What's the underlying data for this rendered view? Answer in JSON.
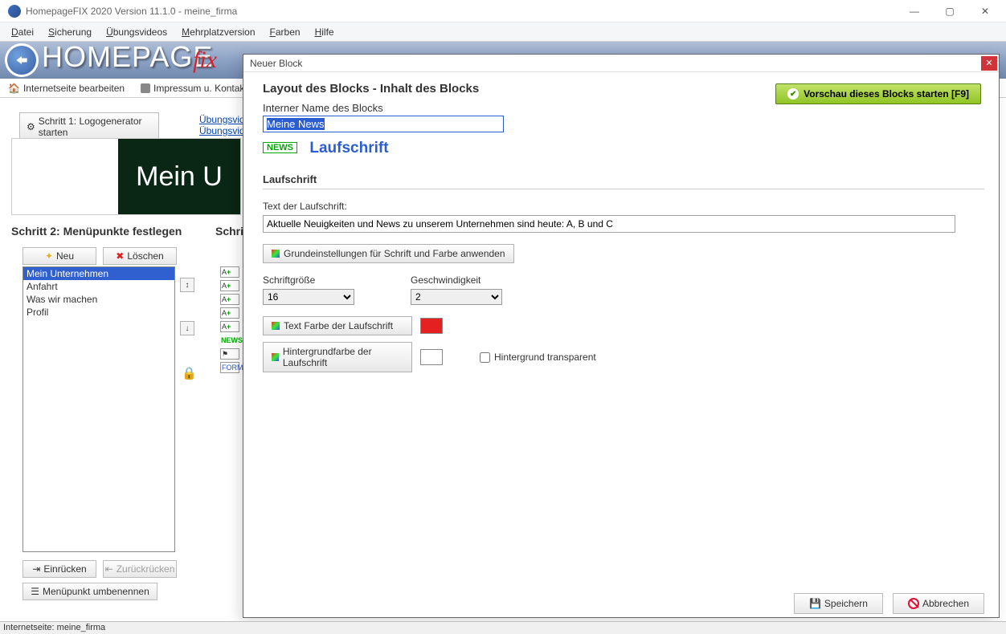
{
  "window": {
    "title": "HomepageFIX 2020 Version 11.1.0 - meine_firma"
  },
  "menus": [
    "Datei",
    "Sicherung",
    "Übungsvideos",
    "Mehrplatzversion",
    "Farben",
    "Hilfe"
  ],
  "banner": {
    "text": "HOMEPAGE",
    "cursive": "fix"
  },
  "tabs": {
    "edit": "Internetseite bearbeiten",
    "impressum": "Impressum u. Kontakt"
  },
  "logogen_btn": "Schritt 1: Logogenerator starten",
  "links": [
    "Übungsvide",
    "Übungsvide"
  ],
  "hero_text": "Mein U",
  "step2": {
    "title": "Schritt 2: Menüpunkte festlegen",
    "new": "Neu",
    "delete": "Löschen",
    "items": [
      "Mein Unternehmen",
      "Anfahrt",
      "Was wir machen",
      "Profil"
    ],
    "indent": "Einrücken",
    "outdent": "Zurückrücken",
    "rename": "Menüpunkt umbenennen"
  },
  "step3": {
    "title": "Schri",
    "news": "NEWS",
    "form": "FORM"
  },
  "dialog": {
    "title": "Neuer Block",
    "layout_header": "Layout des Blocks - Inhalt des Blocks",
    "name_label": "Interner Name des Blocks",
    "name_value": "Meine News",
    "news_badge": "NEWS",
    "type_title": "Laufschrift",
    "preview_btn": "Vorschau dieses Blocks starten [F9]",
    "section": "Laufschrift",
    "text_label": "Text der Laufschrift:",
    "text_value": "Aktuelle Neuigkeiten und News zu unserem Unternehmen sind heute: A, B und C",
    "apply_defaults": "Grundeinstellungen für Schrift und Farbe anwenden",
    "fontsize_label": "Schriftgröße",
    "fontsize_value": "16",
    "speed_label": "Geschwindigkeit",
    "speed_value": "2",
    "textcolor_btn": "Text Farbe der Laufschrift",
    "bgcolor_btn": "Hintergrundfarbe der Laufschrift",
    "transparent": "Hintergrund transparent",
    "text_swatch": "#E52020",
    "bg_swatch": "#FFFFFF",
    "save": "Speichern",
    "cancel": "Abbrechen"
  },
  "statusbar": "Internetseite: meine_firma"
}
